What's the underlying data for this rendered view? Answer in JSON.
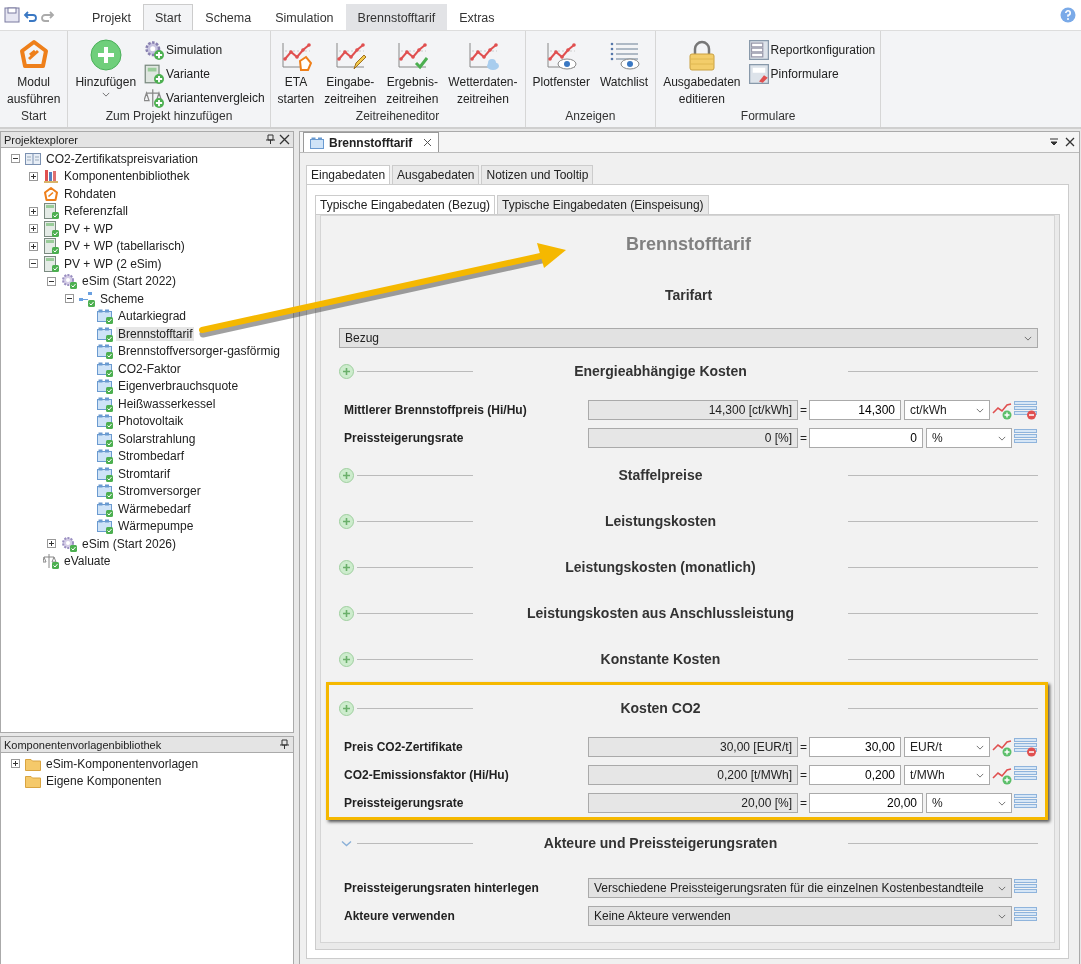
{
  "quick_access_tabs": [
    {
      "label": "Projekt",
      "selected": false,
      "contextual": false
    },
    {
      "label": "Start",
      "selected": true,
      "contextual": false
    },
    {
      "label": "Schema",
      "selected": false,
      "contextual": false
    },
    {
      "label": "Simulation",
      "selected": false,
      "contextual": false
    },
    {
      "label": "Brennstofftarif",
      "selected": false,
      "contextual": true
    },
    {
      "label": "Extras",
      "selected": false,
      "contextual": false
    }
  ],
  "ribbon_groups": [
    {
      "label": "Start",
      "items": [
        {
          "kind": "large",
          "lines": [
            "Modul",
            "ausführen"
          ],
          "dropdown": false
        }
      ]
    },
    {
      "label": "Zum Projekt hinzufügen",
      "items": [
        {
          "kind": "large",
          "lines": [
            "Hinzufügen"
          ],
          "dropdown": true
        },
        {
          "kind": "small",
          "label": "Simulation"
        },
        {
          "kind": "small",
          "label": "Variante"
        },
        {
          "kind": "small",
          "label": "Variantenvergleich"
        }
      ]
    },
    {
      "label": "Zeitreiheneditor",
      "items": [
        {
          "kind": "large",
          "lines": [
            "ETA",
            "starten"
          ],
          "dropdown": false
        },
        {
          "kind": "large",
          "lines": [
            "Eingabe-",
            "zeitreihen"
          ],
          "dropdown": false
        },
        {
          "kind": "large",
          "lines": [
            "Ergebnis-",
            "zeitreihen"
          ],
          "dropdown": false
        },
        {
          "kind": "large",
          "lines": [
            "Wetterdaten-",
            "zeitreihen"
          ],
          "dropdown": false
        }
      ]
    },
    {
      "label": "Anzeigen",
      "items": [
        {
          "kind": "large",
          "lines": [
            "Plotfenster"
          ],
          "dropdown": false
        },
        {
          "kind": "large",
          "lines": [
            "Watchlist"
          ],
          "dropdown": false
        }
      ]
    },
    {
      "label": "Formulare",
      "items": [
        {
          "kind": "large",
          "lines": [
            "Ausgabedaten",
            "editieren"
          ],
          "dropdown": false
        },
        {
          "kind": "small",
          "label": "Reportkonfiguration"
        },
        {
          "kind": "small",
          "label": "Pinformulare"
        }
      ]
    }
  ],
  "project_explorer": {
    "title": "Projektexplorer",
    "tree": [
      {
        "label": "CO2-Zertifikatspreisvariation",
        "kind": "project",
        "expanded": true,
        "selected": false,
        "children": [
          {
            "label": "Komponentenbibliothek",
            "kind": "library",
            "expanded": false,
            "selected": false
          },
          {
            "label": "Rohdaten",
            "kind": "rawdata",
            "selected": false
          },
          {
            "label": "Referenzfall",
            "kind": "variant",
            "expanded": false,
            "selected": false
          },
          {
            "label": "PV + WP",
            "kind": "variant",
            "expanded": false,
            "selected": false
          },
          {
            "label": "PV + WP (tabellarisch)",
            "kind": "variant",
            "expanded": false,
            "selected": false
          },
          {
            "label": "PV + WP (2 eSim)",
            "kind": "variant",
            "expanded": true,
            "selected": false,
            "children": [
              {
                "label": "eSim (Start 2022)",
                "kind": "esim",
                "expanded": true,
                "selected": false,
                "children": [
                  {
                    "label": "Scheme",
                    "kind": "scheme",
                    "expanded": true,
                    "selected": false,
                    "children": [
                      {
                        "label": "Autarkiegrad",
                        "kind": "component",
                        "selected": false
                      },
                      {
                        "label": "Brennstofftarif",
                        "kind": "component",
                        "selected": true
                      },
                      {
                        "label": "Brennstoffversorger-gasförmig",
                        "kind": "component",
                        "selected": false
                      },
                      {
                        "label": "CO2-Faktor",
                        "kind": "component",
                        "selected": false
                      },
                      {
                        "label": "Eigenverbrauchsquote",
                        "kind": "component",
                        "selected": false
                      },
                      {
                        "label": "Heißwasserkessel",
                        "kind": "component",
                        "selected": false
                      },
                      {
                        "label": "Photovoltaik",
                        "kind": "component",
                        "selected": false
                      },
                      {
                        "label": "Solarstrahlung",
                        "kind": "component",
                        "selected": false
                      },
                      {
                        "label": "Strombedarf",
                        "kind": "component",
                        "selected": false
                      },
                      {
                        "label": "Stromtarif",
                        "kind": "component",
                        "selected": false
                      },
                      {
                        "label": "Stromversorger",
                        "kind": "component",
                        "selected": false
                      },
                      {
                        "label": "Wärmebedarf",
                        "kind": "component",
                        "selected": false
                      },
                      {
                        "label": "Wärmepumpe",
                        "kind": "component",
                        "selected": false
                      }
                    ]
                  }
                ]
              },
              {
                "label": "eSim (Start 2026)",
                "kind": "esim",
                "expanded": false,
                "selected": false
              }
            ]
          },
          {
            "label": "eValuate",
            "kind": "evaluate",
            "selected": false
          }
        ]
      }
    ]
  },
  "template_library": {
    "title": "Komponentenvorlagenbibliothek",
    "tree": [
      {
        "label": "eSim-Komponentenvorlagen",
        "kind": "folder",
        "expanded": false,
        "selected": false
      },
      {
        "label": "Eigene Komponenten",
        "kind": "folder",
        "selected": false
      }
    ]
  },
  "document": {
    "tab": "Brennstofftarif",
    "tabs": [
      {
        "label": "Eingabedaten",
        "selected": true
      },
      {
        "label": "Ausgabedaten",
        "selected": false
      },
      {
        "label": "Notizen und Tooltip",
        "selected": false
      }
    ],
    "subtabs": [
      {
        "label": "Typische Eingabedaten (Bezug)",
        "selected": true
      },
      {
        "label": "Typische Eingabedaten (Einspeisung)",
        "selected": false
      }
    ],
    "form": {
      "title": "Brennstofftarif",
      "sections": [
        {
          "title": "Tarifart",
          "kind": "plain",
          "highlighted": false,
          "rows": [
            {
              "kind": "wide_select",
              "value": "Bezug"
            }
          ]
        },
        {
          "title": "Energieabhängige Kosten",
          "kind": "plus",
          "highlighted": false,
          "rows": [
            {
              "kind": "value",
              "label": "Mittlerer Brennstoffpreis (Hi/Hu)",
              "computed": "14,300 [ct/kWh]",
              "relation": "=",
              "value": "14,300",
              "unit": "ct/kWh",
              "timeseries": true,
              "removable": true
            },
            {
              "kind": "value",
              "label": "Preissteigerungsrate",
              "computed": "0 [%]",
              "relation": "=",
              "value": "0",
              "unit": "%",
              "timeseries": false,
              "removable": false
            }
          ]
        },
        {
          "title": "Staffelpreise",
          "kind": "plus",
          "highlighted": false
        },
        {
          "title": "Leistungskosten",
          "kind": "plus",
          "highlighted": false
        },
        {
          "title": "Leistungskosten (monatlich)",
          "kind": "plus",
          "highlighted": false
        },
        {
          "title": "Leistungskosten aus Anschlussleistung",
          "kind": "plus",
          "highlighted": false
        },
        {
          "title": "Konstante Kosten",
          "kind": "plus",
          "highlighted": false
        },
        {
          "title": "Kosten CO2",
          "kind": "plus",
          "highlighted": true,
          "rows": [
            {
              "kind": "value",
              "label": "Preis CO2-Zertifikate",
              "computed": "30,00 [EUR/t]",
              "relation": "=",
              "value": "30,00",
              "unit": "EUR/t",
              "timeseries": true,
              "removable": true
            },
            {
              "kind": "value",
              "label": "CO2-Emissionsfaktor (Hi/Hu)",
              "computed": "0,200 [t/MWh]",
              "relation": "=",
              "value": "0,200",
              "unit": "t/MWh",
              "timeseries": true,
              "removable": false
            },
            {
              "kind": "value",
              "label": "Preissteigerungsrate",
              "computed": "20,00 [%]",
              "relation": "=",
              "value": "20,00",
              "unit": "%",
              "timeseries": false,
              "removable": false
            }
          ]
        },
        {
          "title": "Akteure und Preissteigerungsraten",
          "kind": "chevron",
          "highlighted": false,
          "rows": [
            {
              "kind": "select",
              "label": "Preissteigerungsraten hinterlegen",
              "value": "Verschiedene Preissteigerungsraten für die einzelnen Kostenbestandteile"
            },
            {
              "kind": "select",
              "label": "Akteure verwenden",
              "value": "Keine Akteure verwenden"
            }
          ]
        }
      ]
    }
  }
}
